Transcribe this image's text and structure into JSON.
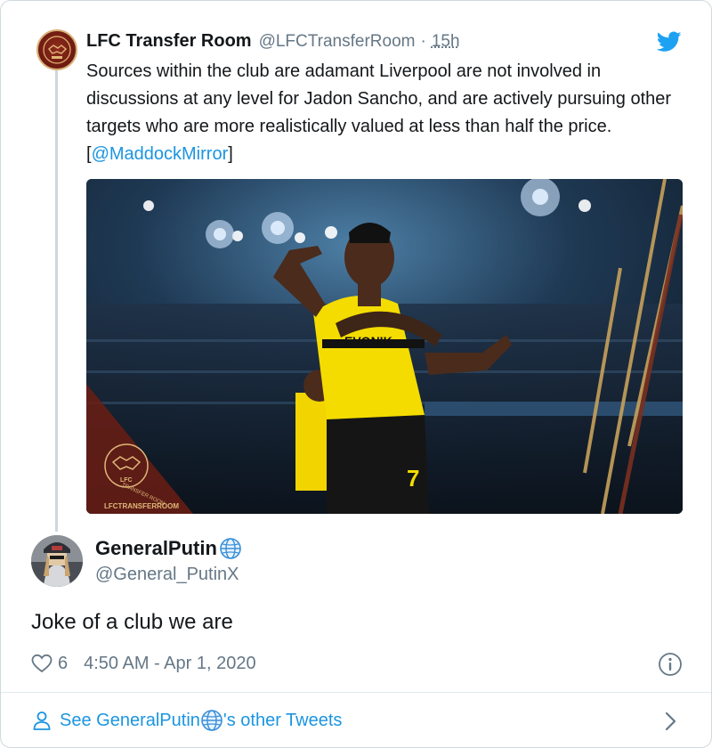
{
  "parent_tweet": {
    "author_name": "LFC Transfer Room",
    "author_handle": "@LFCTransferRoom",
    "separator": "·",
    "time_ago": "15h",
    "text_before_mention": "Sources within the club are adamant Liverpool are not involved in discussions at any level for Jadon Sancho, and are actively pursuing other targets who are more realistically valued at less than half the price. [",
    "mention": "@MaddockMirror",
    "text_after_mention": "]",
    "avatar_icon": "lfc-transfer-room-logo",
    "photo": {
      "watermark_top": "LFC",
      "watermark_middle": "TRANSFER ROOM",
      "watermark_bottom": "LFCTRANSFERROOM",
      "sponsor": "EVONIK",
      "shirt_number": "7"
    }
  },
  "reply_tweet": {
    "author_name": "GeneralPutin",
    "author_handle": "@General_PutinX",
    "text": "Joke of a club we are",
    "like_count": "6",
    "timestamp": "4:50 AM - Apr 1, 2020"
  },
  "footer": {
    "label_prefix": "See GeneralPutin",
    "label_suffix": "'s other Tweets"
  },
  "colors": {
    "link_blue": "#1b95e0",
    "muted_gray": "#657786",
    "twitter_blue": "#1da1f2"
  },
  "icons": [
    "twitter-bird-icon",
    "globe-icon",
    "heart-icon",
    "info-icon",
    "person-icon",
    "chevron-right-icon"
  ]
}
